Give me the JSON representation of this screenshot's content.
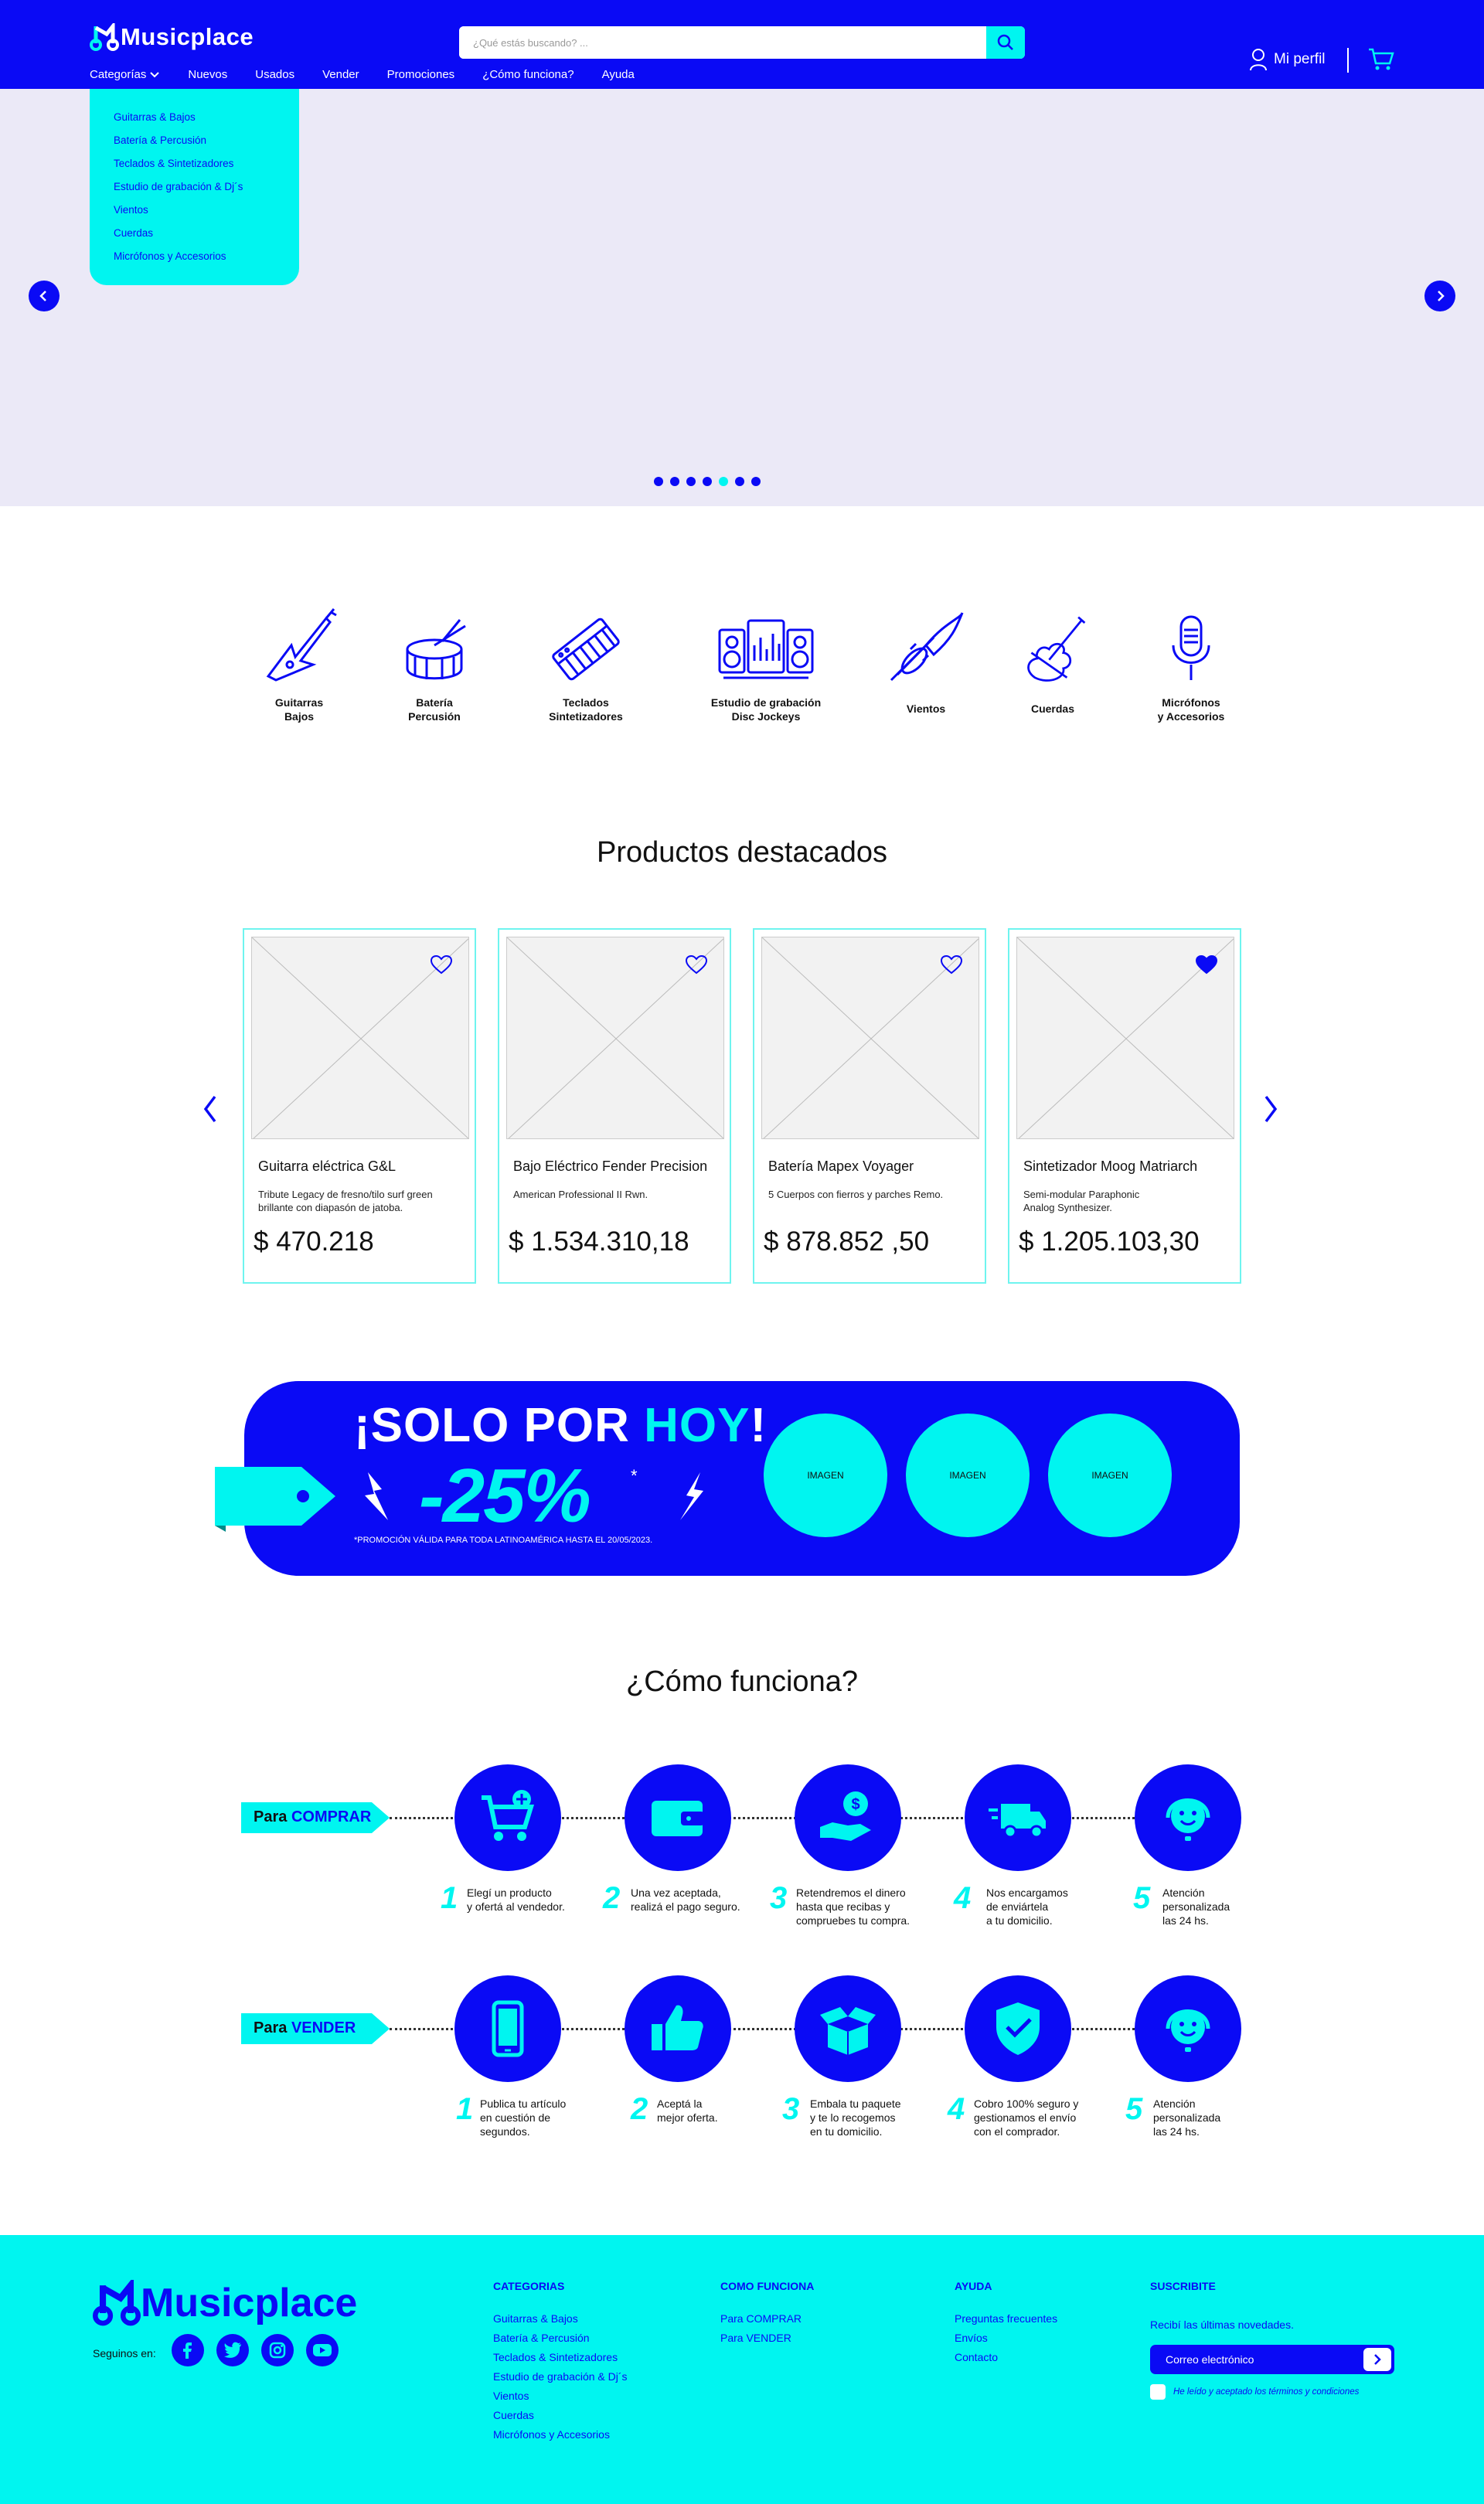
{
  "brand": {
    "name": "Musicplace"
  },
  "header": {
    "search_placeholder": "¿Qué estás buscando? ...",
    "nav": [
      "Categorías",
      "Nuevos",
      "Usados",
      "Vender",
      "Promociones",
      "¿Cómo funciona?",
      "Ayuda"
    ],
    "profile_label": "Mi perfil"
  },
  "dropdown": [
    "Guitarras & Bajos",
    "Batería  & Percusión",
    "Teclados & Sintetizadores",
    "Estudio de grabación & Dj´s",
    "Vientos",
    "Cuerdas",
    "Micrófonos y Accesorios"
  ],
  "hero": {
    "slide_count": 7,
    "active_slide": 5
  },
  "categories": [
    {
      "line1": "Guitarras",
      "line2": "Bajos",
      "icon": "guitar-icon"
    },
    {
      "line1": "Batería",
      "line2": "Percusión",
      "icon": "drum-icon"
    },
    {
      "line1": "Teclados",
      "line2": "Sintetizadores",
      "icon": "keyboard-icon"
    },
    {
      "line1": "Estudio de grabación",
      "line2": "Disc Jockeys",
      "icon": "studio-icon"
    },
    {
      "line1": "Vientos",
      "line2": "",
      "icon": "trumpet-icon"
    },
    {
      "line1": "Cuerdas",
      "line2": "",
      "icon": "violin-icon"
    },
    {
      "line1": "Micrófonos",
      "line2": "y Accesorios",
      "icon": "microphone-icon"
    }
  ],
  "featured": {
    "title": "Productos destacados",
    "products": [
      {
        "name": "Guitarra eléctrica G&L",
        "desc": "Tribute Legacy de fresno/tilo surf green brillante con diapasón de jatoba.",
        "price": "$ 470.218",
        "favorite": false
      },
      {
        "name": "Bajo Eléctrico Fender Precision",
        "desc": "American Professional II Rwn.",
        "price": "$ 1.534.310,18",
        "favorite": false
      },
      {
        "name": "Batería Mapex Voyager",
        "desc": "5 Cuerpos con fierros y parches Remo.",
        "price": "$ 878.852 ,50",
        "favorite": false
      },
      {
        "name": "Sintetizador Moog Matriarch",
        "desc": "Semi-modular Paraphonic Analog Synthesizer.",
        "price": "$ 1.205.103,30",
        "favorite": true
      }
    ]
  },
  "promo": {
    "line1_a": "¡SOLO POR ",
    "line1_b": "HOY",
    "line1_c": "!",
    "discount": "-25%",
    "asterisk": "*",
    "legal": "*PROMOCIÓN VÁLIDA PARA TODA LATINOAMÉRICA HASTA EL 20/05/2023.",
    "images": [
      "IMAGEN",
      "IMAGEN",
      "IMAGEN"
    ]
  },
  "how": {
    "title": "¿Cómo funciona?",
    "buy": {
      "label_a": "Para ",
      "label_b": "COMPRAR",
      "steps": [
        {
          "n": "1",
          "text": "Elegí un producto\ny ofertá al vendedor.",
          "icon": "cart-plus-icon"
        },
        {
          "n": "2",
          "text": "Una vez aceptada,\nrealizá el pago seguro.",
          "icon": "wallet-icon"
        },
        {
          "n": "3",
          "text": "Retendremos el dinero\nhasta que recibas y\ncompruebes tu compra.",
          "icon": "money-hand-icon"
        },
        {
          "n": "4",
          "text": "Nos encargamos\nde enviártela\na tu domicilio.",
          "icon": "truck-icon"
        },
        {
          "n": "5",
          "text": "Atención\npersonalizada\nlas 24 hs.",
          "icon": "support-icon"
        }
      ]
    },
    "sell": {
      "label_a": "Para ",
      "label_b": "VENDER",
      "steps": [
        {
          "n": "1",
          "text": "Publica tu artículo\nen cuestión de\nsegundos.",
          "icon": "phone-icon"
        },
        {
          "n": "2",
          "text": "Aceptá la\nmejor oferta.",
          "icon": "thumbs-up-icon"
        },
        {
          "n": "3",
          "text": "Embala tu paquete\ny te lo recogemos\nen tu domicilio.",
          "icon": "box-icon"
        },
        {
          "n": "4",
          "text": "Cobro 100% seguro y\ngestionamos el envío\ncon el comprador.",
          "icon": "shield-check-icon"
        },
        {
          "n": "5",
          "text": "Atención\npersonalizada\nlas 24 hs.",
          "icon": "support-icon"
        }
      ]
    }
  },
  "footer": {
    "follow": "Seguinos en:",
    "categories_title": "CATEGORIAS",
    "categories": [
      "Guitarras & Bajos",
      "Batería  & Percusión",
      "Teclados & Sintetizadores",
      "Estudio de grabación & Dj´s",
      "Vientos",
      "Cuerdas",
      "Micrófonos y Accesorios"
    ],
    "how_title": "COMO FUNCIONA",
    "how_links": [
      "Para COMPRAR",
      "Para VENDER"
    ],
    "help_title": "AYUDA",
    "help_links": [
      "Preguntas frecuentes",
      "Envíos",
      "Contacto"
    ],
    "subscribe_title": "SUSCRIBITE",
    "subscribe_text": "Recibí las últimas novedades.",
    "email_placeholder": "Correo electrónico",
    "terms": "He leído y aceptado los términos y condiciones"
  },
  "colors": {
    "primary": "#0a0af5",
    "accent": "#00f5f0",
    "hero_bg": "#ebe9f7"
  }
}
